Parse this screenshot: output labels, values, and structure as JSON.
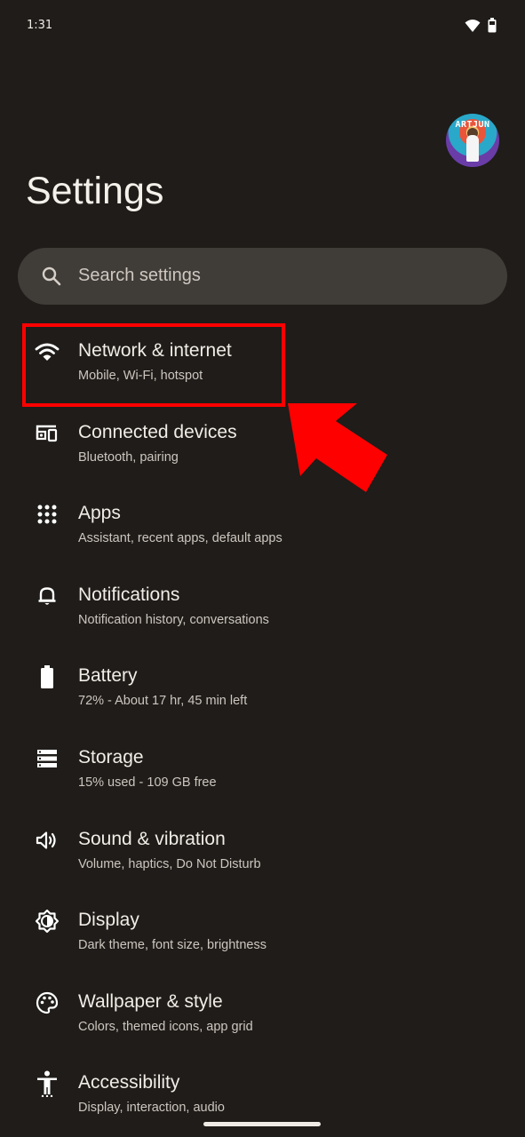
{
  "status_bar": {
    "time": "1:31",
    "icons": [
      "wifi-icon",
      "battery-icon"
    ]
  },
  "avatar": {
    "text": "ARTJUN"
  },
  "page_title": "Settings",
  "search": {
    "placeholder": "Search settings",
    "icon": "search-icon"
  },
  "items": [
    {
      "id": "network",
      "title": "Network & internet",
      "subtitle": "Mobile, Wi-Fi, hotspot",
      "icon": "wifi-icon"
    },
    {
      "id": "connected-devices",
      "title": "Connected devices",
      "subtitle": "Bluetooth, pairing",
      "icon": "devices-icon"
    },
    {
      "id": "apps",
      "title": "Apps",
      "subtitle": "Assistant, recent apps, default apps",
      "icon": "apps-grid-icon"
    },
    {
      "id": "notifications",
      "title": "Notifications",
      "subtitle": "Notification history, conversations",
      "icon": "bell-icon"
    },
    {
      "id": "battery",
      "title": "Battery",
      "subtitle": "72% - About 17 hr, 45 min left",
      "icon": "battery-icon"
    },
    {
      "id": "storage",
      "title": "Storage",
      "subtitle": "15% used - 109 GB free",
      "icon": "storage-icon"
    },
    {
      "id": "sound",
      "title": "Sound & vibration",
      "subtitle": "Volume, haptics, Do Not Disturb",
      "icon": "speaker-icon"
    },
    {
      "id": "display",
      "title": "Display",
      "subtitle": "Dark theme, font size, brightness",
      "icon": "brightness-icon"
    },
    {
      "id": "wallpaper",
      "title": "Wallpaper & style",
      "subtitle": "Colors, themed icons, app grid",
      "icon": "palette-icon"
    },
    {
      "id": "accessibility",
      "title": "Accessibility",
      "subtitle": "Display, interaction, audio",
      "icon": "accessibility-icon"
    }
  ],
  "colors": {
    "background": "#1f1c19",
    "search_background": "#403c38",
    "highlight": "#ff0000",
    "text_primary": "#f1ece6",
    "text_secondary": "#cdc6bf"
  }
}
